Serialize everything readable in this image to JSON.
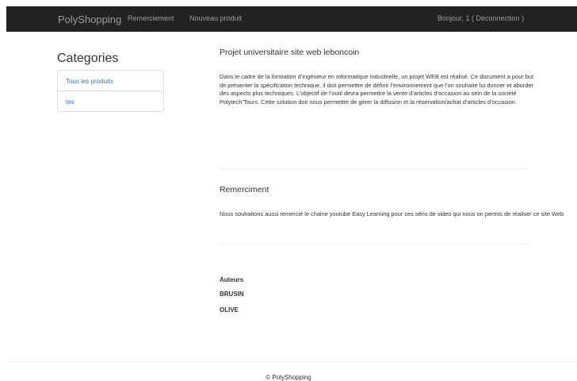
{
  "navbar": {
    "brand": "PolyShopping",
    "links": [
      "Remerciement",
      "Nouveau produit"
    ],
    "user_text": "Bonjour, 1 ( Déconnection )",
    "background": "#222222",
    "text_color": "#9d9d9d"
  },
  "sidebar": {
    "title": "Categories",
    "items": [
      {
        "label": "Tous les produits"
      },
      {
        "label": "tes"
      }
    ]
  },
  "main": {
    "project": {
      "title": "Projet universitaire site web leboncoin",
      "text": "Dans le cadre de la formation d’ingénieur en informatique industrielle, un projet WEB est réalisé. Ce document a pour but de présenter la spécification technique, il doit permettre de définir l’environnement que l’on souhaite lui donner et aborder des aspects plus techniques. L’objectif de l’outil devra permettre la vente d’articles d’occasion au sein de la société Polytech’Tours. Cette solution doit nous permettre de gérer la diffusion et la réservation/achat d’articles d’occasion."
    },
    "thanks": {
      "title": "Remerciment",
      "text": "Nous souhaitons aussi remercié le chaine youtube Easy Learning pour ces séris de video qui nous on permis de réaliser ce site Web"
    },
    "authors": {
      "heading": "Auteurs",
      "names": [
        "BRUSIN",
        "OLIVE"
      ]
    }
  },
  "footer": {
    "text": "© PolyShopping"
  },
  "colors": {
    "link": "#337ab7",
    "text": "#333333",
    "border": "#dddddd"
  }
}
